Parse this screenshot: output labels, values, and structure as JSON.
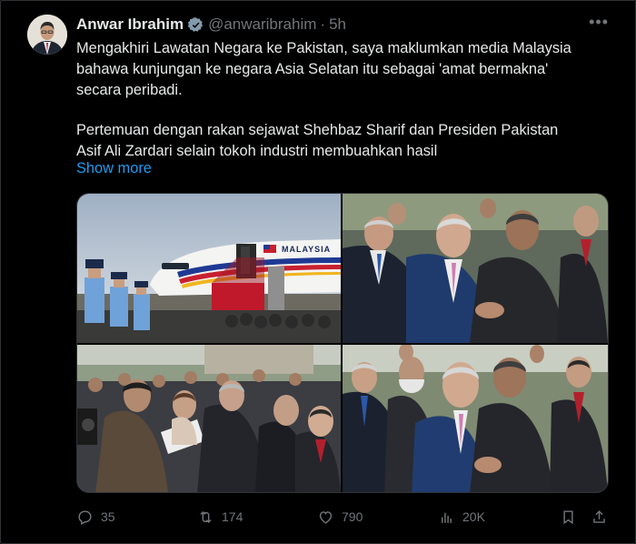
{
  "tweet": {
    "display_name": "Anwar Ibrahim",
    "handle": "@anwaribrahim",
    "separator": "·",
    "time": "5h",
    "more_icon": "more-horizontal-icon",
    "body_paragraph_1": "Mengakhiri Lawatan Negara ke Pakistan, saya maklumkan media Malaysia\nbahawa kunjungan ke negara Asia Selatan itu sebagai 'amat bermakna'\nsecara peribadi.",
    "body_paragraph_2": "Pertemuan dengan rakan sejawat Shehbaz Sharif dan Presiden Pakistan\nAsif Ali Zardari selain tokoh industri membuahkan hasil",
    "show_more": "Show more",
    "photo_1_livery_text": "MALAYSIA"
  },
  "actions": {
    "reply_count": "35",
    "retweet_count": "174",
    "like_count": "790",
    "views_count": "20K"
  },
  "colors": {
    "background": "#000000",
    "text": "#e7e9ea",
    "muted": "#71767b",
    "link": "#1d9bf0",
    "verified": "#829aab"
  }
}
